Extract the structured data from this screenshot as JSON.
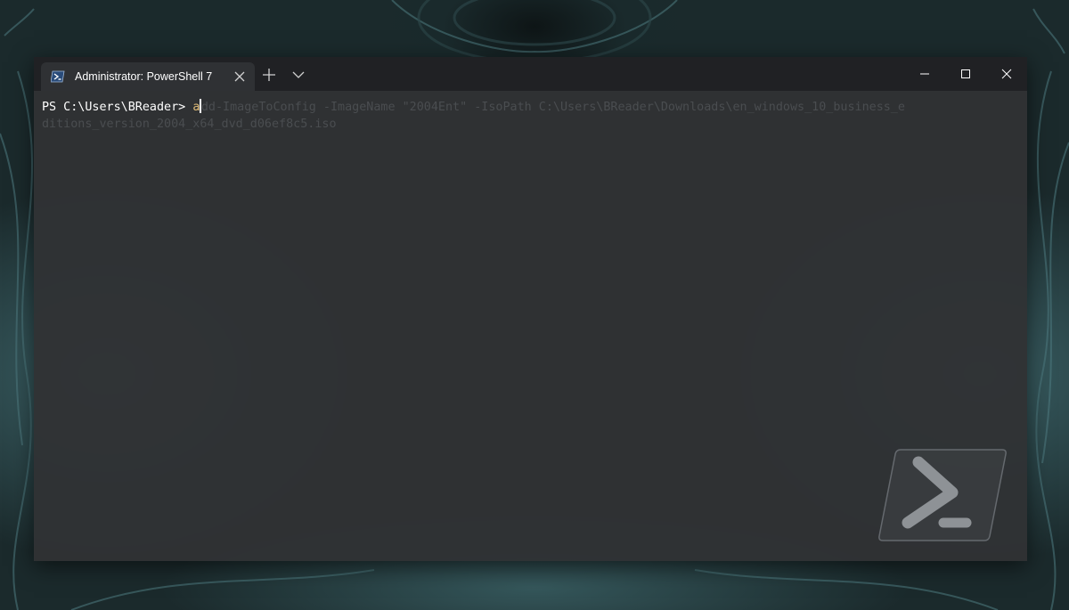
{
  "window": {
    "tab_title": "Administrator: PowerShell 7",
    "tab_icon": "powershell-icon"
  },
  "titlebar_icons": {
    "close_tab": "close-icon",
    "new_tab": "plus-icon",
    "dropdown": "chevron-down-icon",
    "minimize": "minimize-icon",
    "maximize": "maximize-icon",
    "close": "close-icon"
  },
  "terminal": {
    "prompt": "PS C:\\Users\\BReader> ",
    "typed": "a",
    "suggestion_line1": "dd-ImageToConfig -ImageName \"2004Ent\" -IsoPath C:\\Users\\BReader\\Downloads\\en_windows_10_business_e",
    "suggestion_line2": "ditions_version_2004_x64_dvd_d06ef8c5.iso"
  },
  "colors": {
    "titlebar": "#202124",
    "tab_active": "#2f3134",
    "terminal_bg": "#303234",
    "typed_text": "#e5c07b",
    "suggestion_text": "#4a4d50"
  }
}
